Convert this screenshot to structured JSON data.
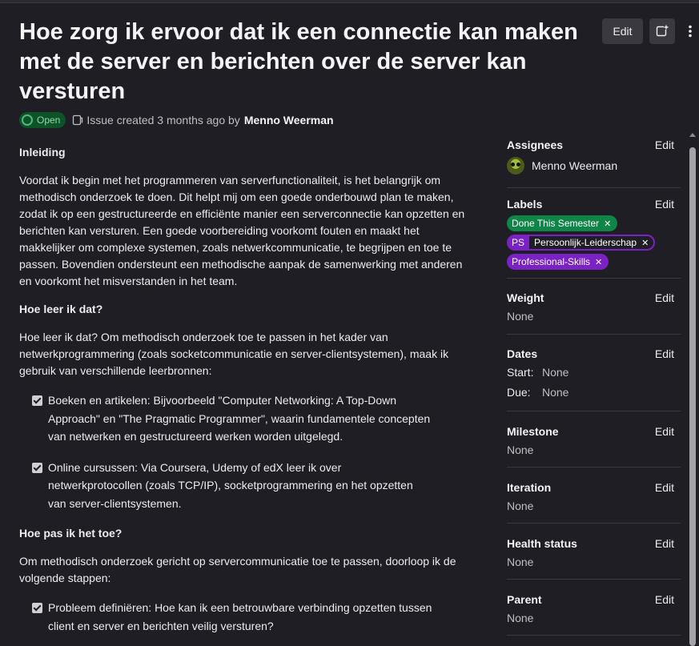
{
  "issue": {
    "title": "Hoe zorg ik ervoor dat ik een connectie kan maken met de server en berichten over de server kan versturen",
    "status": "Open",
    "created_text": "Issue created 3 months ago by",
    "author": "Menno Weerman"
  },
  "header": {
    "edit_label": "Edit"
  },
  "content": {
    "h1": "Inleiding",
    "p1": "Voordat ik begin met het programmeren van serverfunctionaliteit, is het belangrijk om methodisch onderzoek te doen. Dit helpt mij om een goede onderbouwd plan te maken, zodat ik op een gestructureerde en efficiënte manier een serverconnectie kan opzetten en berichten kan versturen. Een goede voorbereiding voorkomt fouten en maakt het makkelijker om complexe systemen, zoals netwerkcommunicatie, te begrijpen en toe te passen. Bovendien ondersteunt een methodische aanpak de samenwerking met anderen en voorkomt het misverstanden in het team.",
    "h2": "Hoe leer ik dat?",
    "p2": "Hoe leer ik dat? Om methodisch onderzoek toe te passen in het kader van netwerkprogrammering (zoals socketcommunicatie en server-clientsystemen), maak ik gebruik van verschillende leerbronnen:",
    "list1": [
      "Boeken en artikelen: Bijvoorbeeld \"Computer Networking: A Top-Down Approach\" en \"The Pragmatic Programmer\", waarin fundamentele concepten van netwerken en gestructureerd werken worden uitgelegd.",
      "Online cursussen: Via Coursera, Udemy of edX leer ik over netwerkprotocollen (zoals TCP/IP), socketprogrammering en het opzetten van server-clientsystemen."
    ],
    "h3": "Hoe pas ik het toe?",
    "p3": "Om methodisch onderzoek gericht op servercommunicatie toe te passen, doorloop ik de volgende stappen:",
    "list2": [
      "Probleem definiëren: Hoe kan ik een betrouwbare verbinding opzetten tussen client en server en berichten veilig versturen?"
    ]
  },
  "sidebar": {
    "edit_label": "Edit",
    "assignees": {
      "label": "Assignees",
      "name": "Menno Weerman"
    },
    "labels": {
      "label": "Labels",
      "items": [
        {
          "text": "Done This Semester",
          "color": "#108548"
        },
        {
          "scope": "PS",
          "text": "Persoonlijk-Leiderschap",
          "color": "#7b22c4"
        },
        {
          "text": "Professional-Skills",
          "color": "#7b22c4"
        }
      ]
    },
    "weight": {
      "label": "Weight",
      "value": "None"
    },
    "dates": {
      "label": "Dates",
      "start_key": "Start:",
      "start": "None",
      "due_key": "Due:",
      "due": "None"
    },
    "milestone": {
      "label": "Milestone",
      "value": "None"
    },
    "iteration": {
      "label": "Iteration",
      "value": "None"
    },
    "health": {
      "label": "Health status",
      "value": "None"
    },
    "parent": {
      "label": "Parent",
      "value": "None"
    }
  }
}
